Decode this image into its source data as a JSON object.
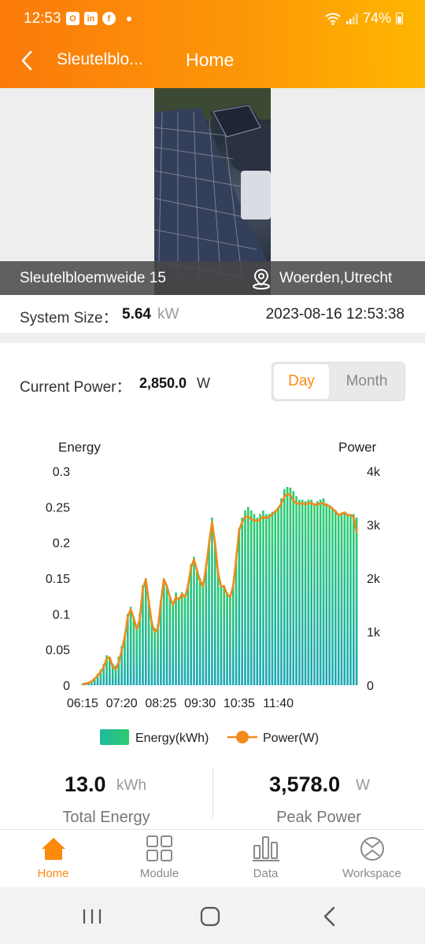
{
  "status_bar": {
    "time": "12:53",
    "battery": "74%"
  },
  "header": {
    "site_name": "Sleutelblo...",
    "title": "Home"
  },
  "site": {
    "name": "Sleutelbloemweide 15",
    "location": "Woerden,Utrecht"
  },
  "system": {
    "size_label": "System Size：",
    "size_value": "5.64",
    "size_unit": "kW",
    "datetime": "2023-08-16 12:53:38"
  },
  "current_power": {
    "label": "Current Power：",
    "value": "2,850.0",
    "unit": "W"
  },
  "period_toggle": {
    "day": "Day",
    "month": "Month",
    "selected": "Day"
  },
  "totals": {
    "energy_value": "13.0",
    "energy_unit": "kWh",
    "energy_label": "Total Energy",
    "peak_value": "3,578.0",
    "peak_unit": "W",
    "peak_label": "Peak Power"
  },
  "tabs": [
    {
      "label": "Home",
      "icon": "home-icon",
      "active": true
    },
    {
      "label": "Module",
      "icon": "module-grid-icon",
      "active": false
    },
    {
      "label": "Data",
      "icon": "bar-chart-icon",
      "active": false
    },
    {
      "label": "Workspace",
      "icon": "workspace-icon",
      "active": false
    }
  ],
  "colors": {
    "accent": "#fb8a0d",
    "energy": "#24c08a",
    "power": "#f08a1c"
  },
  "chart_data": {
    "type": "bar",
    "left_axis_label": "Energy",
    "right_axis_label": "Power",
    "left_ticks": [
      "0",
      "0.05",
      "0.1",
      "0.15",
      "0.2",
      "0.25",
      "0.3"
    ],
    "right_ticks": [
      "0",
      "1k",
      "2k",
      "3k",
      "4k"
    ],
    "ylim_left": [
      0,
      0.3
    ],
    "ylim_right": [
      0,
      4000
    ],
    "x_ticks": [
      "06:15",
      "07:20",
      "08:25",
      "09:30",
      "10:35",
      "11:40"
    ],
    "x_start": "06:15",
    "interval_minutes": 5,
    "legend": [
      "Energy(kWh)",
      "Power(W)"
    ],
    "series": [
      {
        "name": "Energy(kWh)",
        "values": [
          0.002,
          0.003,
          0.004,
          0.006,
          0.01,
          0.016,
          0.022,
          0.03,
          0.042,
          0.04,
          0.03,
          0.028,
          0.04,
          0.055,
          0.07,
          0.1,
          0.11,
          0.095,
          0.08,
          0.1,
          0.14,
          0.15,
          0.12,
          0.09,
          0.08,
          0.085,
          0.12,
          0.15,
          0.14,
          0.125,
          0.115,
          0.13,
          0.12,
          0.13,
          0.125,
          0.14,
          0.17,
          0.18,
          0.16,
          0.15,
          0.145,
          0.17,
          0.2,
          0.235,
          0.2,
          0.16,
          0.14,
          0.14,
          0.13,
          0.125,
          0.14,
          0.18,
          0.22,
          0.235,
          0.245,
          0.25,
          0.245,
          0.24,
          0.235,
          0.24,
          0.245,
          0.24,
          0.24,
          0.243,
          0.245,
          0.25,
          0.262,
          0.275,
          0.278,
          0.277,
          0.272,
          0.265,
          0.26,
          0.26,
          0.258,
          0.26,
          0.26,
          0.255,
          0.258,
          0.26,
          0.262,
          0.255,
          0.252,
          0.248,
          0.245,
          0.24,
          0.242,
          0.243,
          0.24,
          0.24,
          0.24,
          0.235
        ]
      },
      {
        "name": "Power(W)",
        "values": [
          20,
          30,
          45,
          70,
          120,
          180,
          250,
          330,
          500,
          520,
          350,
          300,
          430,
          650,
          900,
          1280,
          1420,
          1250,
          1050,
          1230,
          1800,
          1980,
          1560,
          1150,
          1000,
          1050,
          1550,
          1980,
          1850,
          1650,
          1500,
          1650,
          1600,
          1700,
          1650,
          1850,
          2200,
          2350,
          2150,
          1950,
          1850,
          2200,
          2650,
          3050,
          2650,
          2100,
          1850,
          1850,
          1700,
          1650,
          1850,
          2350,
          2900,
          3050,
          3150,
          3150,
          3100,
          3080,
          3070,
          3100,
          3150,
          3120,
          3150,
          3200,
          3250,
          3300,
          3400,
          3520,
          3578,
          3550,
          3450,
          3400,
          3390,
          3400,
          3380,
          3400,
          3410,
          3370,
          3380,
          3400,
          3400,
          3360,
          3350,
          3300,
          3250,
          3180,
          3200,
          3230,
          3180,
          3180,
          3150,
          2850
        ]
      }
    ]
  }
}
